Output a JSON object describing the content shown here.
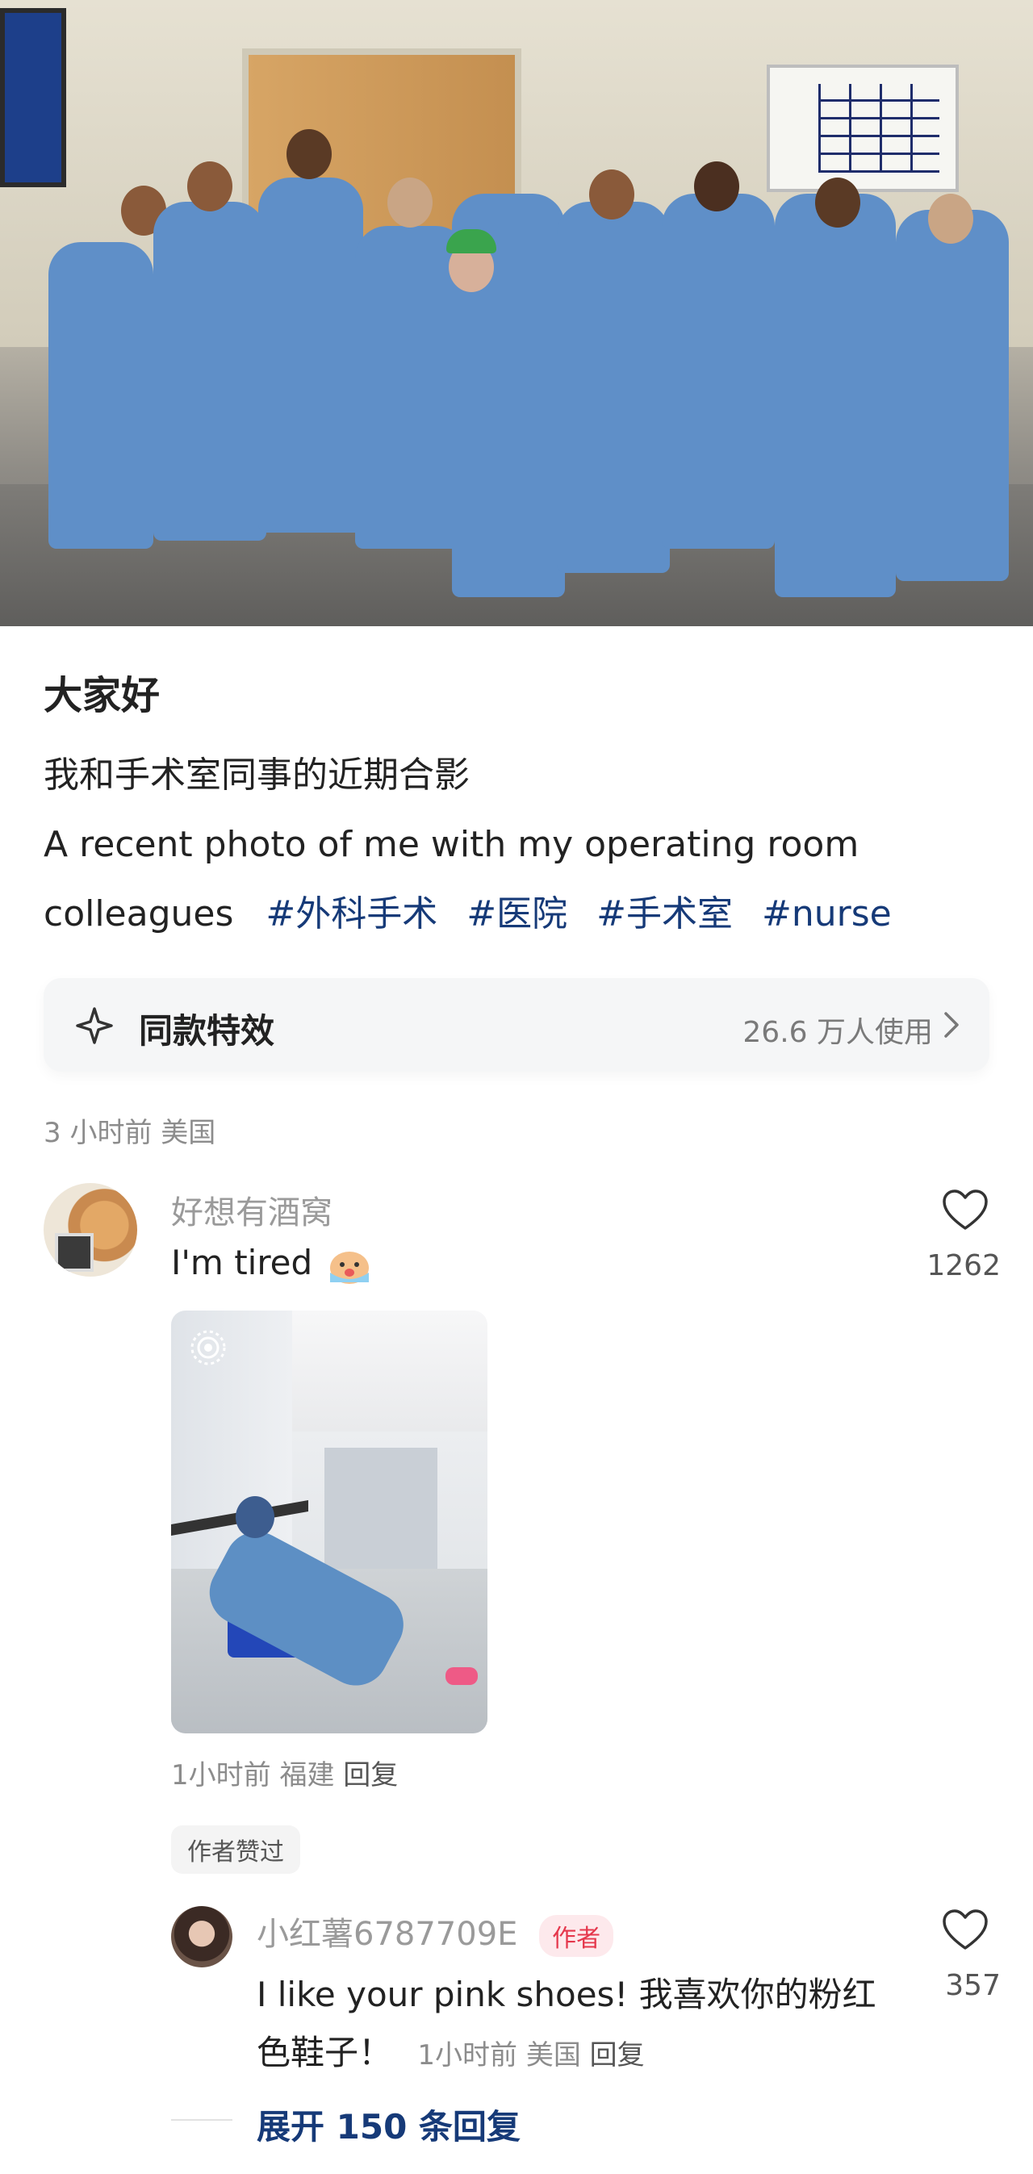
{
  "post": {
    "title": "大家好",
    "line_cn": "我和手术室同事的近期合影",
    "line_en": "A recent photo of me with my operating room",
    "line_en2": "colleagues",
    "tags": [
      "#外科手术",
      "#医院",
      "#手术室",
      "#nurse"
    ],
    "effect": {
      "label": "同款特效",
      "count": "26.6 万人使用"
    },
    "meta": "3 小时前  美国"
  },
  "comment1": {
    "author": "好想有酒窝",
    "text": "I'm tired",
    "likes": "1262",
    "meta": "1小时前  福建",
    "reply": "回复",
    "liked_by_author": "作者赞过"
  },
  "comment2": {
    "author": "小红薯6787709E",
    "author_badge": "作者",
    "text": "I like your pink shoes! 我喜欢你的粉红色鞋子！",
    "likes": "357",
    "meta": "1小时前  美国",
    "reply": "回复"
  },
  "expand_replies": "展开 150 条回复",
  "colors": {
    "link": "#163a78",
    "author_badge_bg": "#fde9ec",
    "author_badge_text": "#e5374c",
    "scrubs": "#5f8fc8"
  },
  "icons": [
    "sparkle-icon",
    "chevron-right-icon",
    "heart-icon",
    "live-photo-icon"
  ]
}
